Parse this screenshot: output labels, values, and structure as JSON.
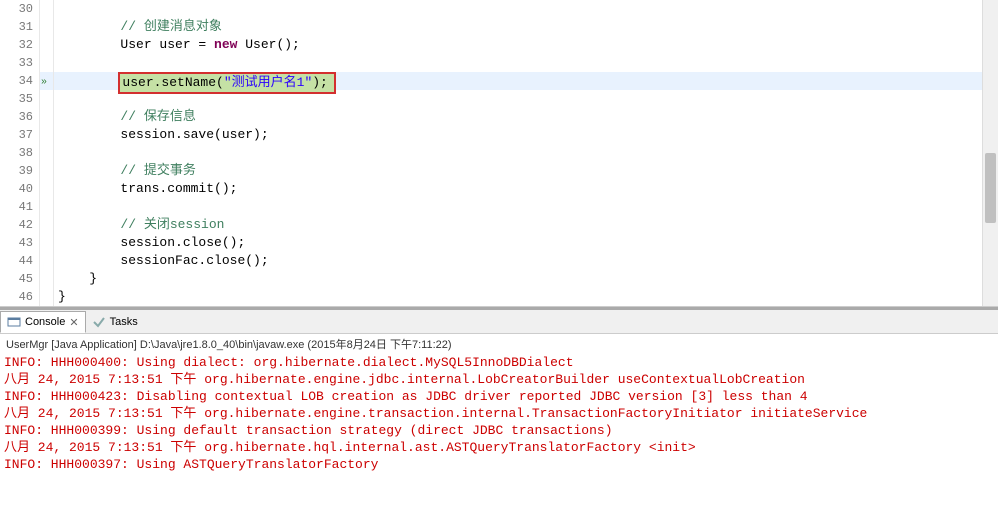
{
  "editor": {
    "lines": [
      {
        "n": "30",
        "indent": "        ",
        "tokens": []
      },
      {
        "n": "31",
        "indent": "        ",
        "tokens": [
          {
            "t": "cmt",
            "v": "// 创建消息对象"
          }
        ]
      },
      {
        "n": "32",
        "indent": "        ",
        "tokens": [
          {
            "t": "type",
            "v": "User user = "
          },
          {
            "t": "kw",
            "v": "new"
          },
          {
            "t": "type",
            "v": " User();"
          }
        ]
      },
      {
        "n": "33",
        "indent": "        ",
        "tokens": []
      },
      {
        "n": "34",
        "indent": "        ",
        "hl": true,
        "bp": true,
        "box": true,
        "tokens": [
          {
            "t": "method",
            "v": "user.setName("
          },
          {
            "t": "str",
            "v": "\"测试用户名1\""
          },
          {
            "t": "method",
            "v": ");"
          }
        ]
      },
      {
        "n": "35",
        "indent": "        ",
        "tokens": []
      },
      {
        "n": "36",
        "indent": "        ",
        "tokens": [
          {
            "t": "cmt",
            "v": "// 保存信息"
          }
        ]
      },
      {
        "n": "37",
        "indent": "        ",
        "tokens": [
          {
            "t": "method",
            "v": "session.save(user);"
          }
        ]
      },
      {
        "n": "38",
        "indent": "        ",
        "tokens": []
      },
      {
        "n": "39",
        "indent": "        ",
        "tokens": [
          {
            "t": "cmt",
            "v": "// 提交事务"
          }
        ]
      },
      {
        "n": "40",
        "indent": "        ",
        "tokens": [
          {
            "t": "method",
            "v": "trans.commit();"
          }
        ]
      },
      {
        "n": "41",
        "indent": "        ",
        "tokens": []
      },
      {
        "n": "42",
        "indent": "        ",
        "tokens": [
          {
            "t": "cmt",
            "v": "// 关闭session"
          }
        ]
      },
      {
        "n": "43",
        "indent": "        ",
        "tokens": [
          {
            "t": "method",
            "v": "session.close();"
          }
        ]
      },
      {
        "n": "44",
        "indent": "        ",
        "tokens": [
          {
            "t": "method",
            "v": "sessionFac.close();"
          }
        ]
      },
      {
        "n": "45",
        "indent": "    ",
        "tokens": [
          {
            "t": "punct",
            "v": "}"
          }
        ]
      },
      {
        "n": "46",
        "indent": "",
        "tokens": [
          {
            "t": "punct",
            "v": "}"
          }
        ]
      }
    ]
  },
  "tabs": {
    "console": "Console",
    "tasks": "Tasks",
    "close": "✕"
  },
  "console": {
    "header": "UserMgr [Java Application] D:\\Java\\jre1.8.0_40\\bin\\javaw.exe (2015年8月24日 下午7:11:22)",
    "lines": [
      "INFO: HHH000400: Using dialect: org.hibernate.dialect.MySQL5InnoDBDialect",
      "八月 24, 2015 7:13:51 下午 org.hibernate.engine.jdbc.internal.LobCreatorBuilder useContextualLobCreation",
      "INFO: HHH000423: Disabling contextual LOB creation as JDBC driver reported JDBC version [3] less than 4",
      "八月 24, 2015 7:13:51 下午 org.hibernate.engine.transaction.internal.TransactionFactoryInitiator initiateService",
      "INFO: HHH000399: Using default transaction strategy (direct JDBC transactions)",
      "八月 24, 2015 7:13:51 下午 org.hibernate.hql.internal.ast.ASTQueryTranslatorFactory <init>",
      "INFO: HHH000397: Using ASTQueryTranslatorFactory"
    ]
  }
}
